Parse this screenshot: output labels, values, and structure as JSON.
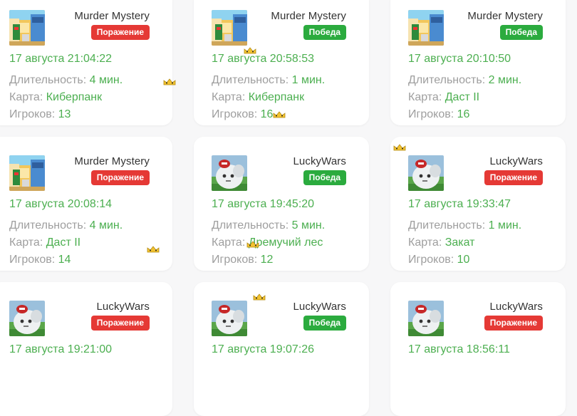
{
  "labels": {
    "duration": "Длительность: ",
    "map": "Карта: ",
    "players": "Игроков: "
  },
  "colors": {
    "loss": "#e53935",
    "win": "#2bab3e",
    "value": "#4caf50",
    "label": "#9e9e9e"
  },
  "cards": [
    {
      "mode": "Murder Mystery",
      "result": "Поражение",
      "date": "17 августа 21:04:22",
      "duration": "4 мин.",
      "map": "Киберпанк",
      "players": "13",
      "thumb": "murder-mystery-thumbnail"
    },
    {
      "mode": "Murder Mystery",
      "result": "Победа",
      "date": "17 августа 20:58:53",
      "duration": "1 мин.",
      "map": "Киберпанк",
      "players": "16",
      "thumb": "murder-mystery-thumbnail"
    },
    {
      "mode": "Murder Mystery",
      "result": "Победа",
      "date": "17 августа 20:10:50",
      "duration": "2 мин.",
      "map": "Даст II",
      "players": "16",
      "thumb": "murder-mystery-thumbnail"
    },
    {
      "mode": "Murder Mystery",
      "result": "Поражение",
      "date": "17 августа 20:08:14",
      "duration": "4 мин.",
      "map": "Даст II",
      "players": "14",
      "thumb": "murder-mystery-thumbnail"
    },
    {
      "mode": "LuckyWars",
      "result": "Победа",
      "date": "17 августа 19:45:20",
      "duration": "5 мин.",
      "map": "Дремучий лес",
      "players": "12",
      "thumb": "luckywars-thumbnail"
    },
    {
      "mode": "LuckyWars",
      "result": "Поражение",
      "date": "17 августа 19:33:47",
      "duration": "1 мин.",
      "map": "Закат",
      "players": "10",
      "thumb": "luckywars-thumbnail"
    },
    {
      "mode": "LuckyWars",
      "result": "Поражение",
      "date": "17 августа 19:21:00",
      "duration": "",
      "map": "",
      "players": "",
      "thumb": "luckywars-thumbnail"
    },
    {
      "mode": "LuckyWars",
      "result": "Победа",
      "date": "17 августа 19:07:26",
      "duration": "",
      "map": "",
      "players": "",
      "thumb": "luckywars-thumbnail"
    },
    {
      "mode": "LuckyWars",
      "result": "Поражение",
      "date": "17 августа 18:56:11",
      "duration": "",
      "map": "",
      "players": "",
      "thumb": "luckywars-thumbnail"
    }
  ],
  "decorations": [
    "crown-icon"
  ]
}
